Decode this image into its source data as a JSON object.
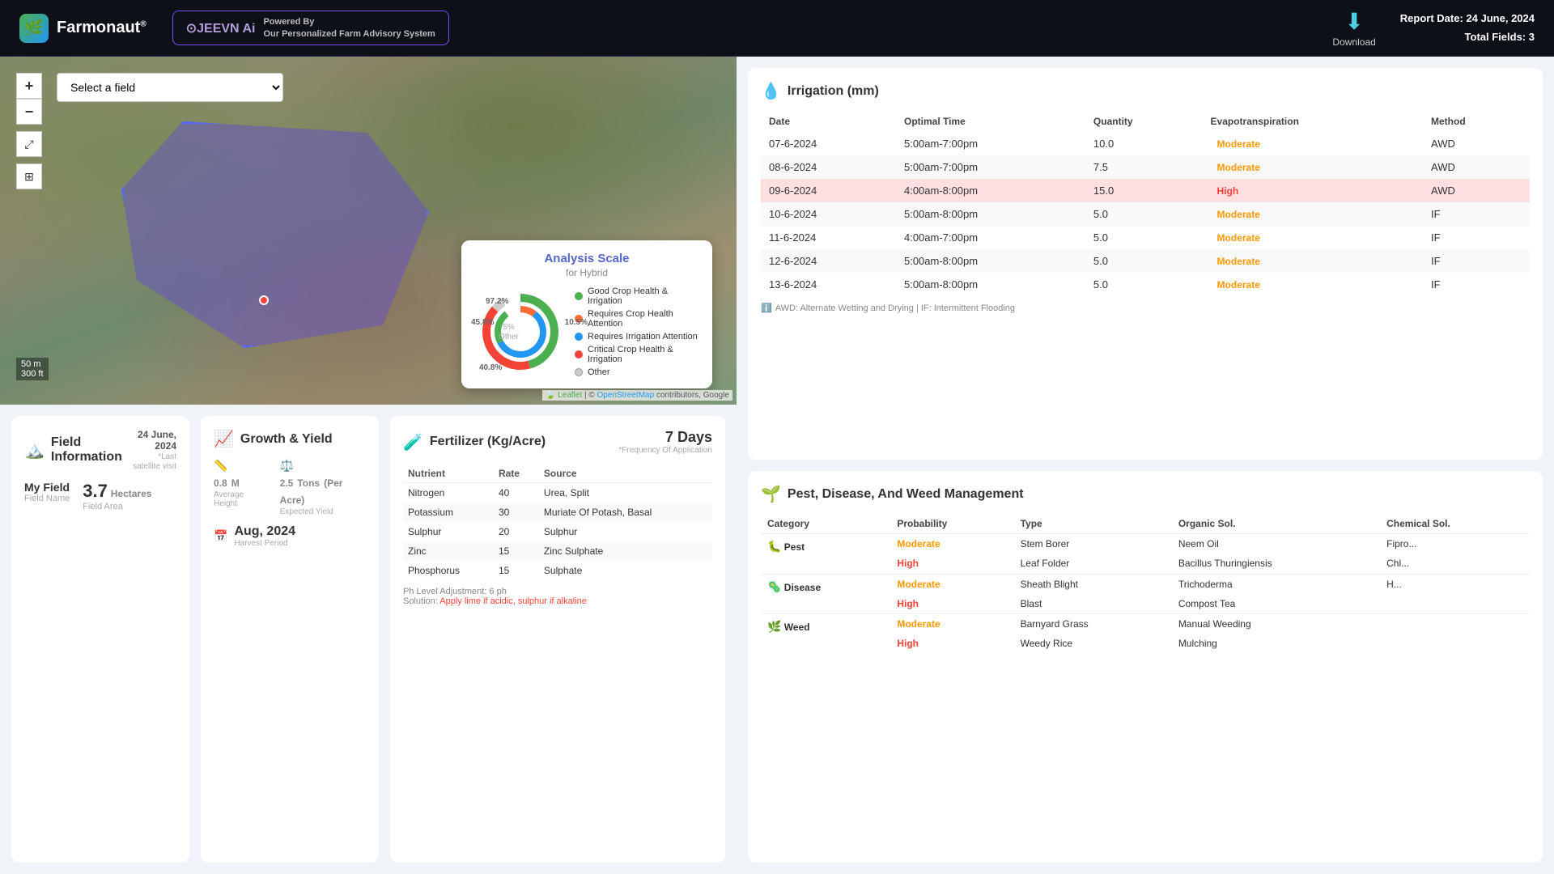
{
  "header": {
    "logo_text": "Farmonaut",
    "logo_reg": "®",
    "jeevn_label": "⊙JEEVN Ai",
    "jeevn_powered": "Powered By",
    "jeevn_desc": "Our Personalized Farm Advisory System",
    "download_label": "Download",
    "report_date_label": "Report Date:",
    "report_date": "24 June, 2024",
    "total_fields_label": "Total Fields:",
    "total_fields": "3"
  },
  "map": {
    "field_select_placeholder": "Select a field",
    "zoom_in": "+",
    "zoom_out": "−",
    "scale_m": "50 m",
    "scale_ft": "300 ft",
    "attribution": "Leaflet | © OpenStreetMap contributors, Google"
  },
  "analysis_scale": {
    "title": "Analysis Scale",
    "subtitle": "for Hybrid",
    "label_972": "97.2%",
    "label_105": "10.5%",
    "label_458": "45.8%",
    "label_408": "40.8%",
    "label_5other": "5% Other",
    "legend": [
      {
        "color": "#4CAF50",
        "label": "Good Crop Health & Irrigation"
      },
      {
        "color": "#FF6B35",
        "label": "Requires Crop Health Attention"
      },
      {
        "color": "#2196F3",
        "label": "Requires Irrigation Attention"
      },
      {
        "color": "#f44336",
        "label": "Critical Crop Health & Irrigation"
      },
      {
        "color": "#ccc",
        "label": "Other",
        "circle": true
      }
    ]
  },
  "field_info": {
    "title": "Field Information",
    "date": "24 June, 2024",
    "date_sub": "*Last satellite visit",
    "field_name_label": "Field Name",
    "field_name_value": "My Field",
    "field_area_label": "Field Area",
    "hectares_value": "3.7",
    "hectares_unit": "Hectares"
  },
  "growth": {
    "title": "Growth & Yield",
    "height_value": "0.8",
    "height_unit": "M",
    "height_label": "Average Height",
    "yield_value": "2.5",
    "yield_unit": "Tons",
    "yield_per": "(Per Acre)",
    "yield_label": "Expected Yield",
    "harvest_value": "Aug, 2024",
    "harvest_label": "Harvest Period"
  },
  "fertilizer": {
    "title": "Fertilizer (Kg/Acre)",
    "freq_days": "7 Days",
    "freq_label": "*Frequency Of Application",
    "columns": [
      "Nutrient",
      "Rate",
      "Source"
    ],
    "rows": [
      {
        "nutrient": "Nitrogen",
        "rate": "40",
        "source": "Urea, Split"
      },
      {
        "nutrient": "Potassium",
        "rate": "30",
        "source": "Muriate Of Potash, Basal"
      },
      {
        "nutrient": "Sulphur",
        "rate": "20",
        "source": "Sulphur"
      },
      {
        "nutrient": "Zinc",
        "rate": "15",
        "source": "Zinc Sulphate"
      },
      {
        "nutrient": "Phosphorus",
        "rate": "15",
        "source": "Sulphate"
      }
    ],
    "footer_ph": "Ph Level Adjustment: 6 ph",
    "footer_solution": "Solution:",
    "footer_action": "Apply lime if acidic, sulphur if alkaline"
  },
  "irrigation": {
    "title": "Irrigation (mm)",
    "columns": [
      "Date",
      "Optimal Time",
      "Quantity",
      "Evapotranspiration",
      "Method"
    ],
    "rows": [
      {
        "date": "07-6-2024",
        "time": "5:00am-7:00pm",
        "qty": "10.0",
        "evap": "Moderate",
        "method": "AWD",
        "highlight": false
      },
      {
        "date": "08-6-2024",
        "time": "5:00am-7:00pm",
        "qty": "7.5",
        "evap": "Moderate",
        "method": "AWD",
        "highlight": false
      },
      {
        "date": "09-6-2024",
        "time": "4:00am-8:00pm",
        "qty": "15.0",
        "evap": "High",
        "method": "AWD",
        "highlight": true
      },
      {
        "date": "10-6-2024",
        "time": "5:00am-8:00pm",
        "qty": "5.0",
        "evap": "Moderate",
        "method": "IF",
        "highlight": false
      },
      {
        "date": "11-6-2024",
        "time": "4:00am-7:00pm",
        "qty": "5.0",
        "evap": "Moderate",
        "method": "IF",
        "highlight": false
      },
      {
        "date": "12-6-2024",
        "time": "5:00am-8:00pm",
        "qty": "5.0",
        "evap": "Moderate",
        "method": "IF",
        "highlight": false
      },
      {
        "date": "13-6-2024",
        "time": "5:00am-8:00pm",
        "qty": "5.0",
        "evap": "Moderate",
        "method": "IF",
        "highlight": false
      }
    ],
    "footer": "AWD: Alternate Wetting and Drying | IF: Intermittent Flooding"
  },
  "pest": {
    "title": "Pest, Disease, And Weed Management",
    "columns": [
      "Category",
      "Probability",
      "Type",
      "Organic Sol.",
      "Chemical Sol."
    ],
    "sections": [
      {
        "category": "Pest",
        "icon": "🐛",
        "rows": [
          {
            "probability": "Moderate",
            "type": "Stem Borer",
            "organic": "Neem Oil",
            "chemical": "Fipro..."
          },
          {
            "probability": "High",
            "type": "Leaf Folder",
            "organic": "Bacillus Thuringiensis",
            "chemical": "Chl..."
          }
        ]
      },
      {
        "category": "Disease",
        "icon": "🦠",
        "rows": [
          {
            "probability": "Moderate",
            "type": "Sheath Blight",
            "organic": "Trichoderma",
            "chemical": "H..."
          },
          {
            "probability": "High",
            "type": "Blast",
            "organic": "Compost Tea",
            "chemical": ""
          }
        ]
      },
      {
        "category": "Weed",
        "icon": "🌿",
        "rows": [
          {
            "probability": "Moderate",
            "type": "Barnyard Grass",
            "organic": "Manual Weeding",
            "chemical": ""
          },
          {
            "probability": "High",
            "type": "Weedy Rice",
            "organic": "Mulching",
            "chemical": ""
          }
        ]
      }
    ]
  }
}
